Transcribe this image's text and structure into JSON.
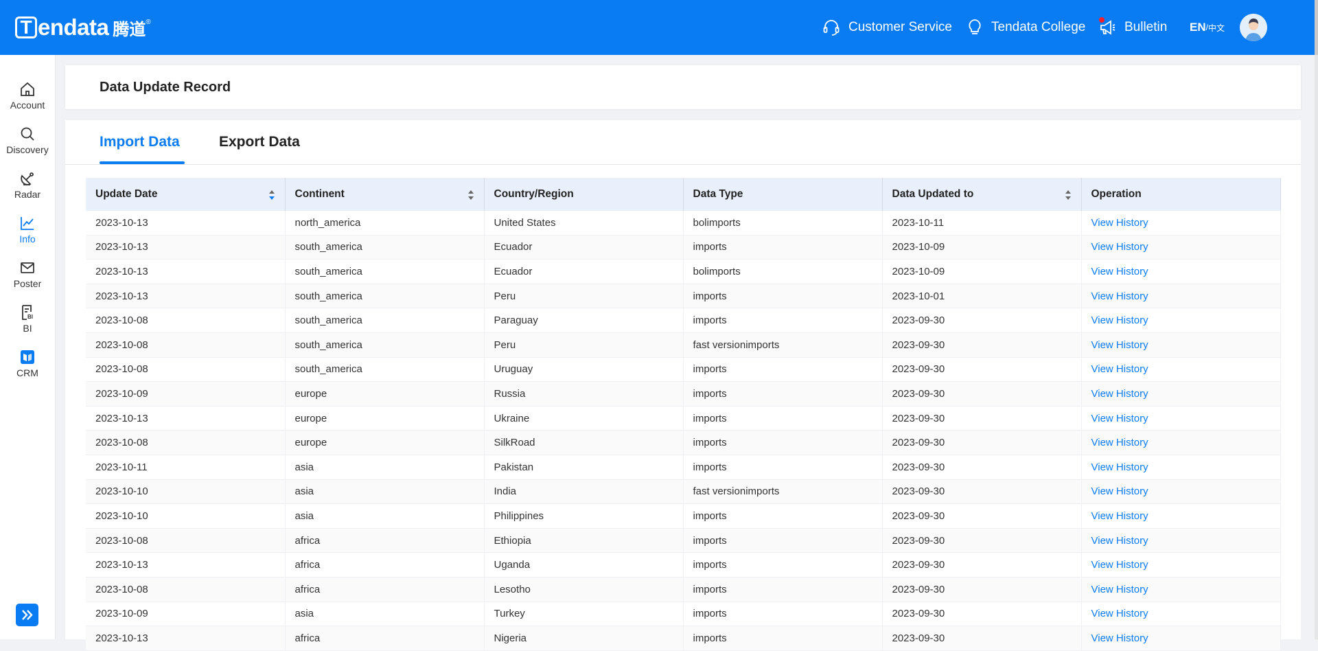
{
  "header": {
    "logo_mark": "T",
    "logo_word": "endata",
    "logo_cn": "腾道",
    "logo_reg": "®",
    "customer_service": "Customer Service",
    "college": "Tendata College",
    "bulletin": "Bulletin",
    "lang_en": "EN",
    "lang_sep": " / ",
    "lang_cn": "中文"
  },
  "sidebar": {
    "items": [
      {
        "label": "Account",
        "icon": "home-icon"
      },
      {
        "label": "Discovery",
        "icon": "search-icon"
      },
      {
        "label": "Radar",
        "icon": "radar-icon"
      },
      {
        "label": "Info",
        "icon": "line-chart-icon",
        "active": true
      },
      {
        "label": "Poster",
        "icon": "mail-icon"
      },
      {
        "label": "BI",
        "icon": "bi-report-icon"
      },
      {
        "label": "CRM",
        "icon": "crm-icon"
      }
    ]
  },
  "page": {
    "title": "Data Update Record",
    "tabs": [
      "Import Data",
      "Export Data"
    ],
    "active_tab": "Import Data"
  },
  "table": {
    "columns": [
      "Update Date",
      "Continent",
      "Country/Region",
      "Data Type",
      "Data Updated to",
      "Operation"
    ],
    "rows": [
      [
        "2023-10-13",
        "north_america",
        "United States",
        "bolimports",
        "2023-10-11",
        "View History"
      ],
      [
        "2023-10-13",
        "south_america",
        "Ecuador",
        "imports",
        "2023-10-09",
        "View History"
      ],
      [
        "2023-10-13",
        "south_america",
        "Ecuador",
        "bolimports",
        "2023-10-09",
        "View History"
      ],
      [
        "2023-10-13",
        "south_america",
        "Peru",
        "imports",
        "2023-10-01",
        "View History"
      ],
      [
        "2023-10-08",
        "south_america",
        "Paraguay",
        "imports",
        "2023-09-30",
        "View History"
      ],
      [
        "2023-10-08",
        "south_america",
        "Peru",
        "fast versionimports",
        "2023-09-30",
        "View History"
      ],
      [
        "2023-10-08",
        "south_america",
        "Uruguay",
        "imports",
        "2023-09-30",
        "View History"
      ],
      [
        "2023-10-09",
        "europe",
        "Russia",
        "imports",
        "2023-09-30",
        "View History"
      ],
      [
        "2023-10-13",
        "europe",
        "Ukraine",
        "imports",
        "2023-09-30",
        "View History"
      ],
      [
        "2023-10-08",
        "europe",
        "SilkRoad",
        "imports",
        "2023-09-30",
        "View History"
      ],
      [
        "2023-10-11",
        "asia",
        "Pakistan",
        "imports",
        "2023-09-30",
        "View History"
      ],
      [
        "2023-10-10",
        "asia",
        "India",
        "fast versionimports",
        "2023-09-30",
        "View History"
      ],
      [
        "2023-10-10",
        "asia",
        "Philippines",
        "imports",
        "2023-09-30",
        "View History"
      ],
      [
        "2023-10-08",
        "africa",
        "Ethiopia",
        "imports",
        "2023-09-30",
        "View History"
      ],
      [
        "2023-10-13",
        "africa",
        "Uganda",
        "imports",
        "2023-09-30",
        "View History"
      ],
      [
        "2023-10-08",
        "africa",
        "Lesotho",
        "imports",
        "2023-09-30",
        "View History"
      ],
      [
        "2023-10-09",
        "asia",
        "Turkey",
        "imports",
        "2023-09-30",
        "View History"
      ],
      [
        "2023-10-13",
        "africa",
        "Nigeria",
        "imports",
        "2023-09-30",
        "View History"
      ]
    ]
  },
  "colors": {
    "brand_blue": "#0a7cf3",
    "header_row": "#e9f0fc",
    "notification_dot": "#f5222d"
  }
}
